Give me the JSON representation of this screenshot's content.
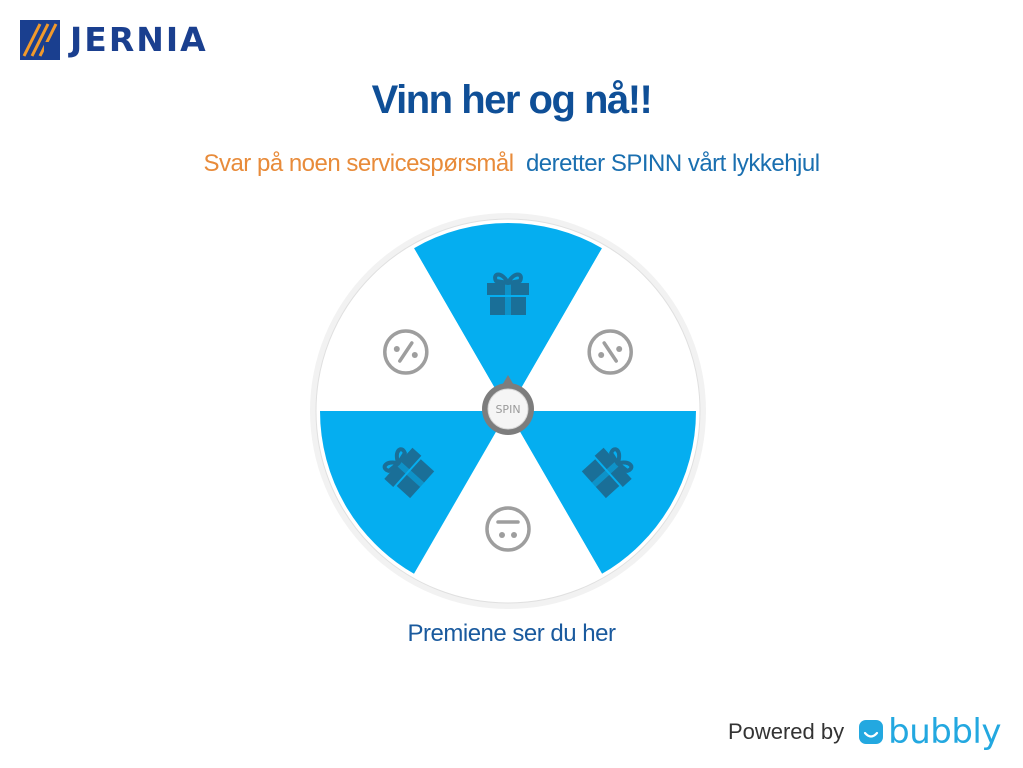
{
  "brand": {
    "name": "JERNIA"
  },
  "header": {
    "title": "Vinn her og nå!!"
  },
  "subtitle": {
    "part1": "Svar på noen servicespørsmål",
    "part2": "deretter SPINN vårt lykkehjul"
  },
  "wheel": {
    "spin_label": "SPIN",
    "segments": [
      {
        "icon": "gift-icon",
        "prize": true
      },
      {
        "icon": "neutral-face-icon",
        "prize": false
      },
      {
        "icon": "gift-icon",
        "prize": true
      },
      {
        "icon": "neutral-face-icon",
        "prize": false
      },
      {
        "icon": "gift-icon",
        "prize": true
      },
      {
        "icon": "neutral-face-icon",
        "prize": false
      }
    ],
    "colors": {
      "prize": "#05aef0",
      "blank": "#ffffff",
      "icon_prize": "#1a6f98",
      "icon_blank": "#9e9e9e"
    }
  },
  "prizes_link": "Premiene ser du her",
  "footer": {
    "powered_label": "Powered by",
    "provider": "bubbly"
  },
  "colors": {
    "brand_blue": "#1a3f8f",
    "title_blue": "#0f4f97",
    "accent_orange": "#e88b3a",
    "bubbly": "#23a8e0"
  }
}
